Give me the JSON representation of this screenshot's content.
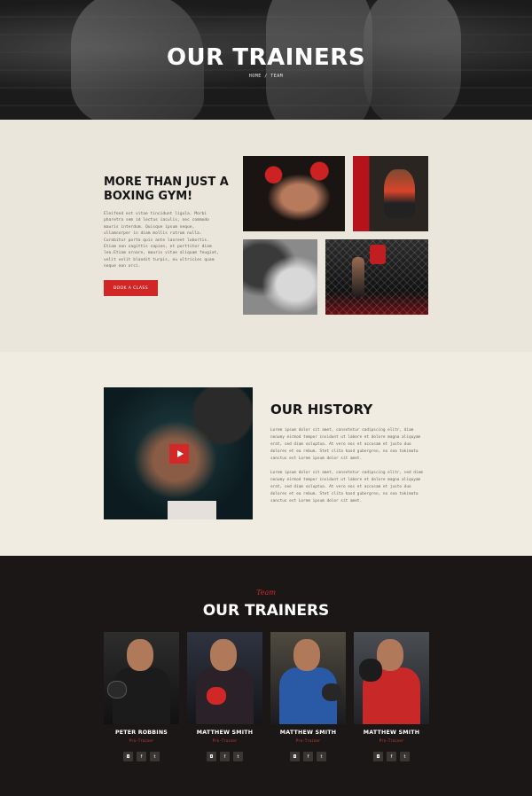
{
  "hero": {
    "title": "OUR TRAINERS",
    "breadcrumb": "HOME / TEAM"
  },
  "about": {
    "heading": "MORE THAN JUST A BOXING GYM!",
    "paragraph": "Eleifend est vitae tincidunt ligula. Morbi pharetra sem id lectus iaculis, nec commodo mauris interdum. Quisque ipsum neque, ullamcorper in diam mollis rutrum nulla. Curabitur porta quis ante laoreet lobortis. Etiam non sagittis sapien, et porttitor diam leo.Etiam ornare, mauris vitae aliquam feugiat, velit velit blandit turpis, eu ultricies quam neque non orci.",
    "button_label": "BOOK A CLASS"
  },
  "history": {
    "heading": "OUR HISTORY",
    "paragraph_1": "Lorem ipsum dolor sit amet, consetetur sadipscing elitr, diam nonumy eirmod tempor invidunt ut labore et dolore magna aliquyam erat, sed diam voluptua. At vero eos et accusam et justo duo dolores et ea rebum. Stet clita kasd gubergren, no sea takimata sanctus est Lorem ipsum dolor sit amet.",
    "paragraph_2": "Lorem ipsum dolor sit amet, consetetur sadipscing elitr, sed diam nonumy eirmod tempor invidunt ut labore et dolore magna aliquyam erat, sed diam voluptua. At vero eos et accusam et justo duo dolores et ea rebum. Stet clita kasd gubergren, no sea takimata sanctus est Lorem ipsum dolor sit amet."
  },
  "trainers": {
    "script_label": "Team",
    "heading": "OUR TRAINERS",
    "cards": [
      {
        "name": "PETER ROBBINS",
        "role": "Pro-Trainer"
      },
      {
        "name": "MATTHEW SMITH",
        "role": "Pro-Trainer"
      },
      {
        "name": "MATTHEW SMITH",
        "role": "Pro-Trainer"
      },
      {
        "name": "MATTHEW SMITH",
        "role": "Pro-Trainer"
      }
    ],
    "social_icons": [
      "instagram-icon",
      "facebook-icon",
      "twitter-icon"
    ],
    "social_glyphs": [
      "◘",
      "f",
      "t"
    ]
  },
  "colors": {
    "accent": "#d02626",
    "light_bg": "#ebe6dc",
    "dark_bg": "#1a1716"
  }
}
